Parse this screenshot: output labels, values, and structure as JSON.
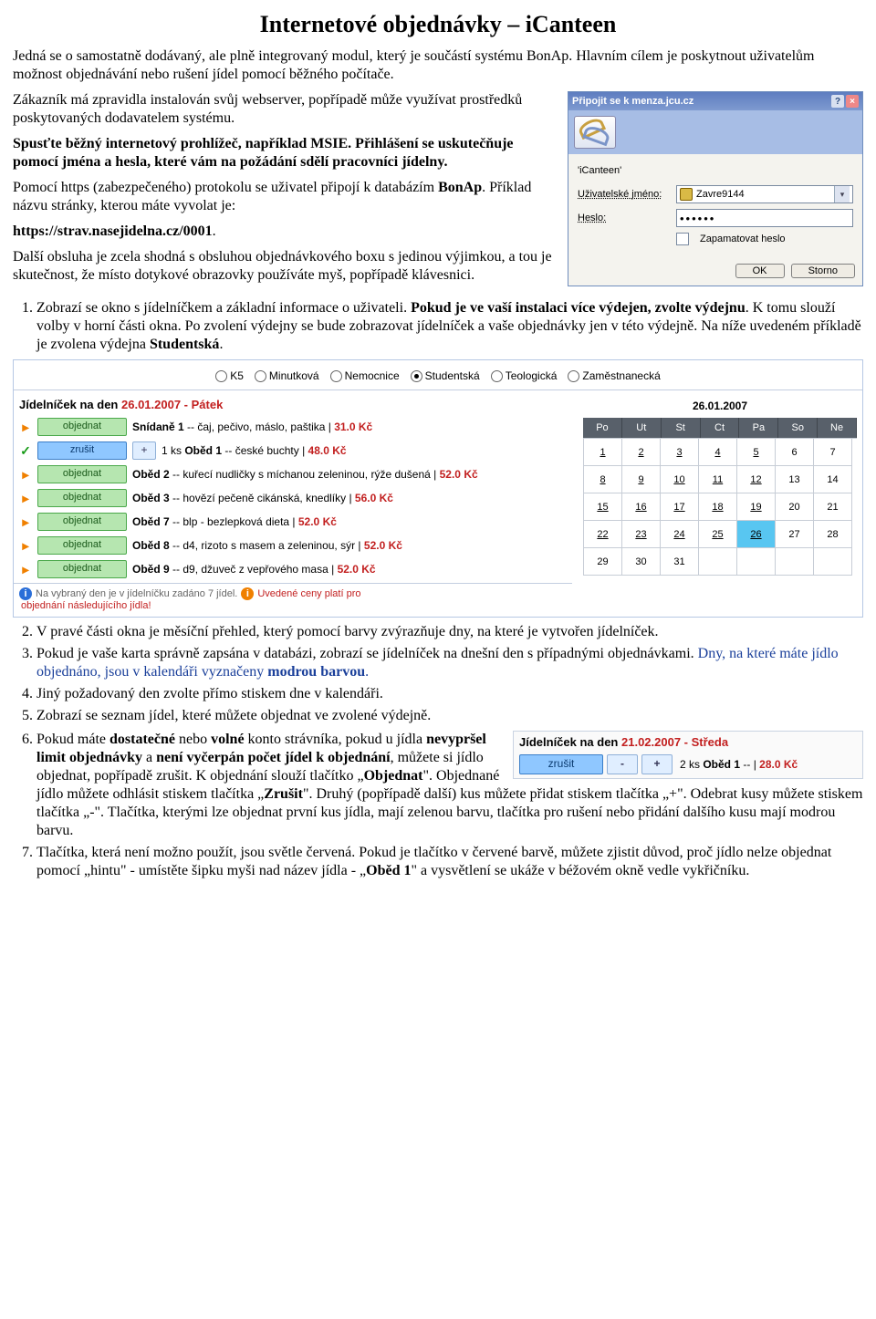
{
  "title": "Internetové objednávky – iCanteen",
  "para1": "Jedná se o samostatně dodávaný, ale plně integrovaný modul, který je součástí systému BonAp. Hlavním cílem je poskytnout uživatelům možnost objednávání nebo rušení jídel pomocí běžného počítače.",
  "para2": "Zákazník má zpravidla instalován svůj webserver, popřípadě může využívat prostředků poskytovaných dodavatelem systému.",
  "para3": "Spusťte běžný internetový prohlížeč, například MSIE. Přihlášení se uskutečňuje pomocí jména a hesla, které vám na požádání sdělí pracovníci jídelny.",
  "para4_a": "Pomocí https (zabezpečeného) protokolu se uživatel připojí k databázím ",
  "para4_b": "BonAp",
  "para4_c": ". Příklad názvu stránky, kterou máte vyvolat je:",
  "url": "https://strav.nasejidelna.cz/0001",
  "para5": "Další obsluha je zcela shodná s obsluhou objednávkového boxu s jedinou výjimkou, a tou je skutečnost, že místo dotykové obrazovky používáte myš, popřípadě klávesnici.",
  "ol1_a": "Zobrazí se okno s jídelníčkem a základní informace o uživateli. ",
  "ol1_b": "Pokud je ve vaší instalaci více výdejen, zvolte výdejnu",
  "ol1_c": ". K tomu slouží volby v horní části okna. Po zvolení výdejny se bude zobrazovat jídelníček a vaše objednávky jen v této výdejně. Na níže uvedeném příkladě je zvolena výdejna ",
  "ol1_d": "Studentská",
  "login": {
    "title": "Připojit se k menza.jcu.cz",
    "realm": "'iCanteen'",
    "user_lbl": "Uživatelské jméno:",
    "user_val": "Zavre9144",
    "pw_lbl": "Heslo:",
    "pw_val": "••••••",
    "remember": "Zapamatovat heslo",
    "ok": "OK",
    "cancel": "Storno"
  },
  "dispensers": [
    "K5",
    "Minutková",
    "Nemocnice",
    "Studentská",
    "Teologická",
    "Zaměstnanecká"
  ],
  "dispenser_selected": 3,
  "menu_date_label": "Jídelníček na den ",
  "menu_date_red": "26.01.2007 - Pátek",
  "btn_order": "objednat",
  "btn_cancel": "zrušit",
  "menu": [
    {
      "type": "order",
      "name": "Snídaně 1",
      "desc": " -- čaj, pečivo, máslo, paštika | ",
      "price": "31.0 Kč"
    },
    {
      "type": "cancel",
      "qty": "1 ks ",
      "name": "Oběd 1",
      "desc": " -- české buchty | ",
      "price": "48.0 Kč"
    },
    {
      "type": "orderwrap",
      "name": "Oběd 2",
      "desc": " -- kuřecí nudličky s míchanou zeleninou, rýže dušená | ",
      "price": "52.0 Kč"
    },
    {
      "type": "order",
      "name": "Oběd 3",
      "desc": " -- hovězí pečeně cikánská, knedlíky | ",
      "price": "56.0 Kč"
    },
    {
      "type": "order",
      "name": "Oběd 7",
      "desc": " -- blp - bezlepková dieta | ",
      "price": "52.0 Kč"
    },
    {
      "type": "order",
      "name": "Oběd 8",
      "desc": " -- d4, rizoto s masem a zeleninou, sýr | ",
      "price": "52.0 Kč"
    },
    {
      "type": "order",
      "name": "Oběd 9",
      "desc": " -- d9, džuveč z vepřového masa | ",
      "price": "52.0 Kč"
    }
  ],
  "footer_a": "Na vybraný den je v jídelníčku zadáno 7 jídel.",
  "footer_b": "Uvedené ceny platí pro",
  "footer_c": "objednání následujícího jídla!",
  "calendar": {
    "date": "26.01.2007",
    "days": [
      "Po",
      "Ut",
      "St",
      "Ct",
      "Pa",
      "So",
      "Ne"
    ],
    "cells": [
      {
        "n": "1",
        "u": 1
      },
      {
        "n": "2",
        "u": 1
      },
      {
        "n": "3",
        "u": 1
      },
      {
        "n": "4",
        "u": 1
      },
      {
        "n": "5",
        "u": 1
      },
      {
        "n": "6"
      },
      {
        "n": "7"
      },
      {
        "n": "8",
        "u": 1
      },
      {
        "n": "9",
        "u": 1
      },
      {
        "n": "10",
        "u": 1
      },
      {
        "n": "11",
        "u": 1
      },
      {
        "n": "12",
        "u": 1
      },
      {
        "n": "13"
      },
      {
        "n": "14"
      },
      {
        "n": "15",
        "u": 1
      },
      {
        "n": "16",
        "u": 1
      },
      {
        "n": "17",
        "u": 1
      },
      {
        "n": "18",
        "u": 1
      },
      {
        "n": "19",
        "u": 1
      },
      {
        "n": "20"
      },
      {
        "n": "21"
      },
      {
        "n": "22",
        "u": 1
      },
      {
        "n": "23",
        "u": 1
      },
      {
        "n": "24",
        "u": 1
      },
      {
        "n": "25",
        "u": 1
      },
      {
        "n": "26",
        "u": 1,
        "sel": 1
      },
      {
        "n": "27"
      },
      {
        "n": "28"
      },
      {
        "n": "29"
      },
      {
        "n": "30"
      },
      {
        "n": "31"
      },
      {
        "n": ""
      },
      {
        "n": ""
      },
      {
        "n": ""
      },
      {
        "n": ""
      }
    ]
  },
  "ol2": "V pravé části okna je měsíční přehled, který pomocí barvy zvýrazňuje dny, na které je vytvořen jídelníček.",
  "ol3_a": "Pokud je vaše karta správně zapsána v databázi, zobrazí se jídelníček na dnešní den s případnými objednávkami. ",
  "ol3_b": "Dny, na které máte jídlo objednáno, jsou v kalendáři vyznačeny ",
  "ol3_c": "modrou barvou",
  "ol4": "Jiný požadovaný den zvolte přímo stiskem dne v kalendáři.",
  "ol5": "Zobrazí se seznam jídel, které můžete objednat ve zvolené výdejně.",
  "ol6_a": "Pokud máte ",
  "ol6_b": "dostatečné",
  "ol6_c": " nebo ",
  "ol6_d": "volné",
  "ol6_e": " konto strávníka, pokud u jídla ",
  "ol6_f": "nevypršel limit objednávky",
  "ol6_g": " a ",
  "ol6_h": "není vyčerpán počet jídel k objednání",
  "ol6_i": ", můžete si jídlo objednat, popřípadě zrušit. K objednání slouží tlačítko „",
  "ol6_j": "Objednat",
  "ol6_k": "\". Objednané jídlo můžete odhlásit stiskem tlačítka „",
  "ol6_l": "Zrušit",
  "ol6_m": "\". Druhý (popřípadě další) kus můžete přidat stiskem tlačítka „+\". Odebrat kusy můžete stiskem tlačítka „-\". Tlačítka, kterými lze objednat první kus jídla, mají zelenou barvu, tlačítka pro rušení nebo přidání dalšího kusu mají modrou barvu.",
  "ol7_a": "Tlačítka, která není možno použít, jsou světle červená. Pokud je tlačítko v červené barvě, můžete zjistit důvod, proč jídlo nelze objednat pomocí „hintu\" - umístěte šipku myši nad název jídla - „",
  "ol7_b": "Oběd 1",
  "ol7_c": "\" a vysvětlení se ukáže v béžovém okně vedle vykřičníku.",
  "snippet": {
    "label": "Jídelníček na den ",
    "red": "21.02.2007 - Středa",
    "cancel": "zrušit",
    "minus": "-",
    "plus": "+",
    "qty": "2 ks ",
    "name": "Oběd 1",
    "sep": " -- | ",
    "price": "28.0 Kč"
  }
}
